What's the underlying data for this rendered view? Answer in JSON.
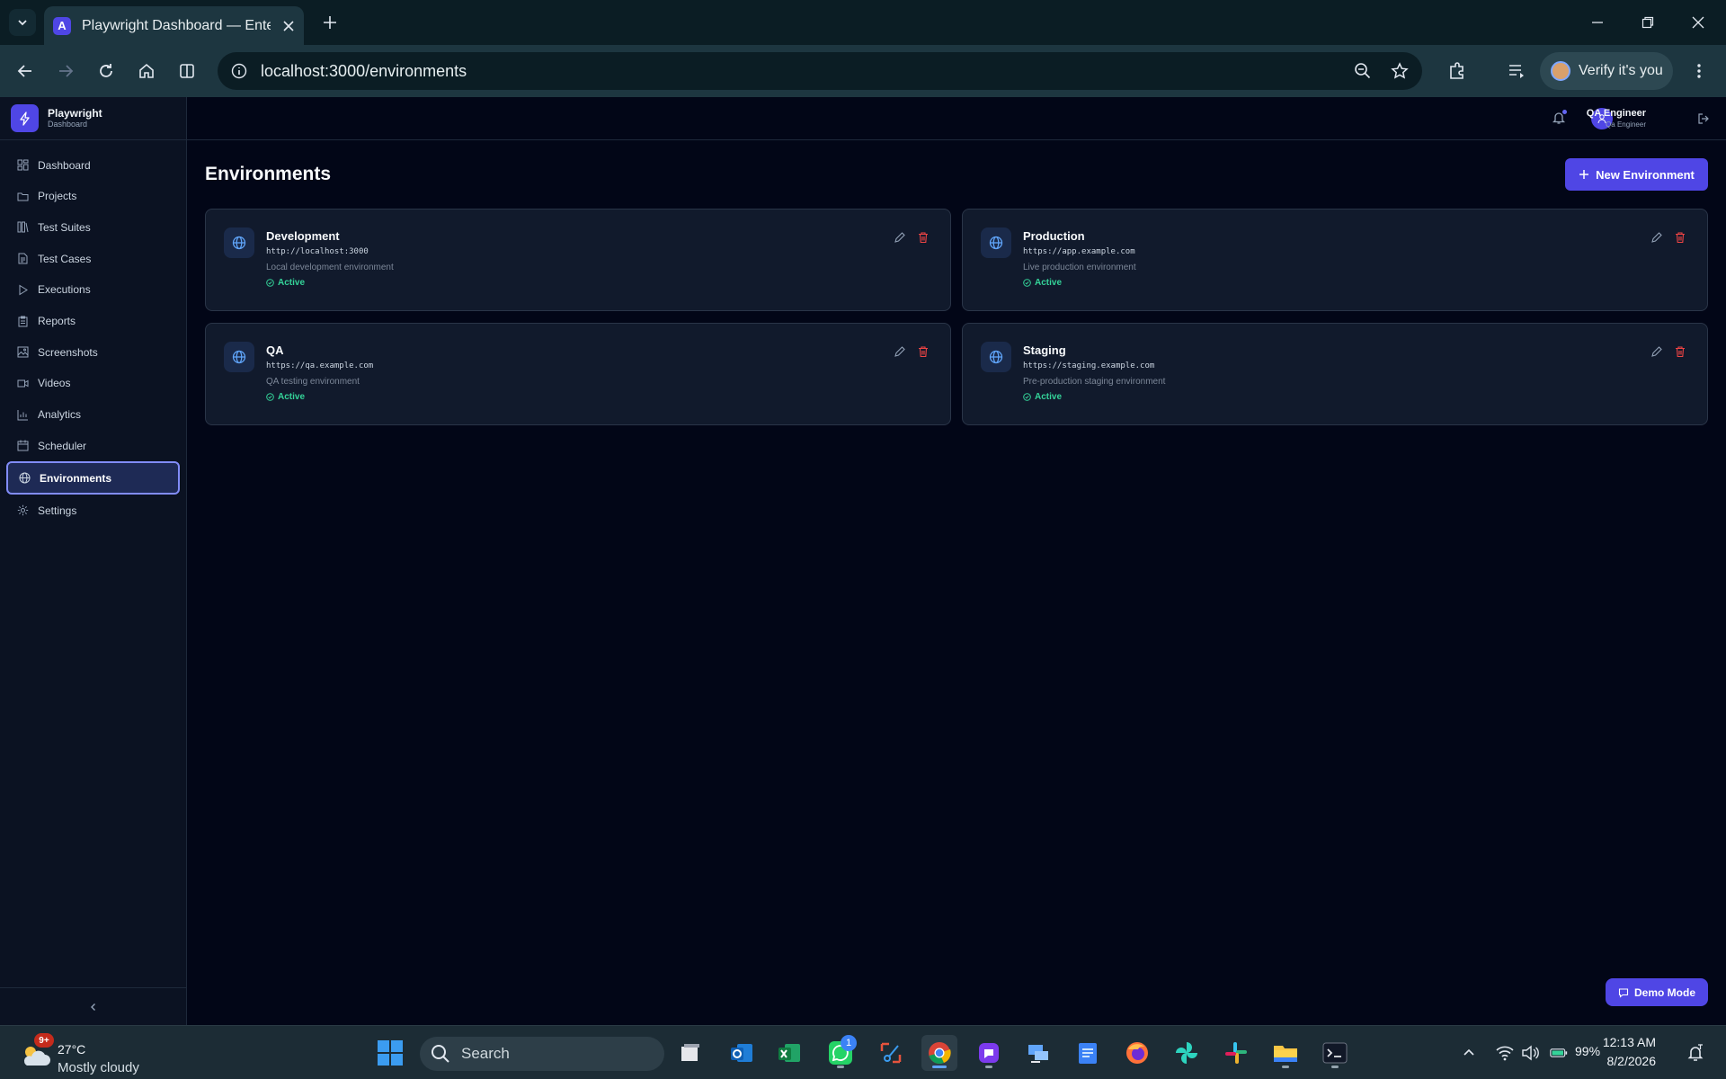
{
  "browser": {
    "tab_title": "Playwright Dashboard — Enterprise",
    "url": "localhost:3000/environments",
    "profile_button": "Verify it's you"
  },
  "app": {
    "brand_name": "Playwright",
    "brand_subtitle": "Dashboard",
    "nav": [
      {
        "label": "Dashboard",
        "icon": "layout-grid-icon"
      },
      {
        "label": "Projects",
        "icon": "folder-icon"
      },
      {
        "label": "Test Suites",
        "icon": "columns-icon"
      },
      {
        "label": "Test Cases",
        "icon": "file-text-icon"
      },
      {
        "label": "Executions",
        "icon": "play-icon"
      },
      {
        "label": "Reports",
        "icon": "clipboard-icon"
      },
      {
        "label": "Screenshots",
        "icon": "image-icon"
      },
      {
        "label": "Videos",
        "icon": "video-icon"
      },
      {
        "label": "Analytics",
        "icon": "bar-chart-icon"
      },
      {
        "label": "Scheduler",
        "icon": "calendar-icon"
      },
      {
        "label": "Environments",
        "icon": "globe-icon",
        "active": true
      },
      {
        "label": "Settings",
        "icon": "gear-icon"
      }
    ],
    "user": {
      "name": "QA Engineer",
      "role": "Qa Engineer"
    },
    "accent_color": "#4f46e5",
    "status_color": "#34d399",
    "delete_color": "#ef4444"
  },
  "page": {
    "title": "Environments",
    "new_button": "New Environment",
    "environments": [
      {
        "name": "Development",
        "url": "http://localhost:3000",
        "description": "Local development environment",
        "status": "Active"
      },
      {
        "name": "Production",
        "url": "https://app.example.com",
        "description": "Live production environment",
        "status": "Active"
      },
      {
        "name": "QA",
        "url": "https://qa.example.com",
        "description": "QA testing environment",
        "status": "Active"
      },
      {
        "name": "Staging",
        "url": "https://staging.example.com",
        "description": "Pre-production staging environment",
        "status": "Active"
      }
    ],
    "demo_button": "Demo Mode"
  },
  "taskbar": {
    "weather_badge": "9+",
    "temperature": "27°C",
    "condition": "Mostly cloudy",
    "search_placeholder": "Search",
    "whatsapp_badge": "1",
    "battery": "99%",
    "time": "12:13 AM",
    "date": "8/2/2026"
  }
}
